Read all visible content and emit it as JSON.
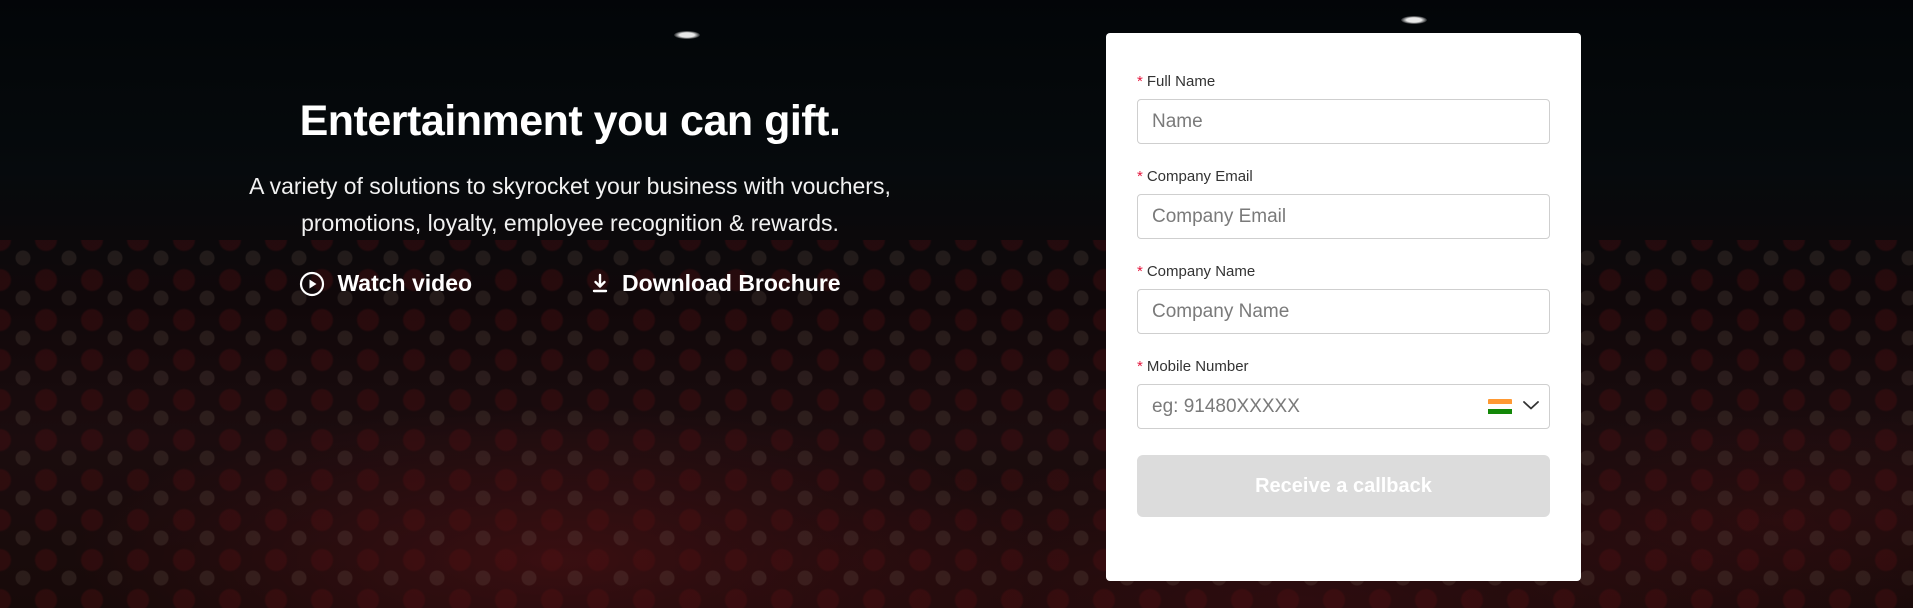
{
  "hero": {
    "title": "Entertainment you can gift.",
    "subtitle": "A variety of solutions to skyrocket your business with vouchers, promotions, loyalty, employee recognition & rewards.",
    "watch_video_label": "Watch video",
    "watch_video_icon": "play-circle-icon",
    "download_label": "Download Brochure",
    "download_icon": "download-icon"
  },
  "form": {
    "full_name": {
      "label": "Full Name",
      "required_mark": "*",
      "placeholder": "Name",
      "value": ""
    },
    "company_email": {
      "label": "Company Email",
      "required_mark": "*",
      "placeholder": "Company Email",
      "value": ""
    },
    "company_name": {
      "label": "Company Name",
      "required_mark": "*",
      "placeholder": "Company Name",
      "value": ""
    },
    "mobile_number": {
      "label": "Mobile Number",
      "required_mark": "*",
      "placeholder": "eg: 91480XXXXX",
      "value": "",
      "country_flag_icon": "india-flag-icon",
      "dropdown_icon": "chevron-down-icon"
    },
    "submit_label": "Receive a callback"
  },
  "colors": {
    "required": "#e5163d",
    "button_disabled_bg": "#dcdcdc",
    "card_bg": "#ffffff",
    "text": "#333333"
  }
}
